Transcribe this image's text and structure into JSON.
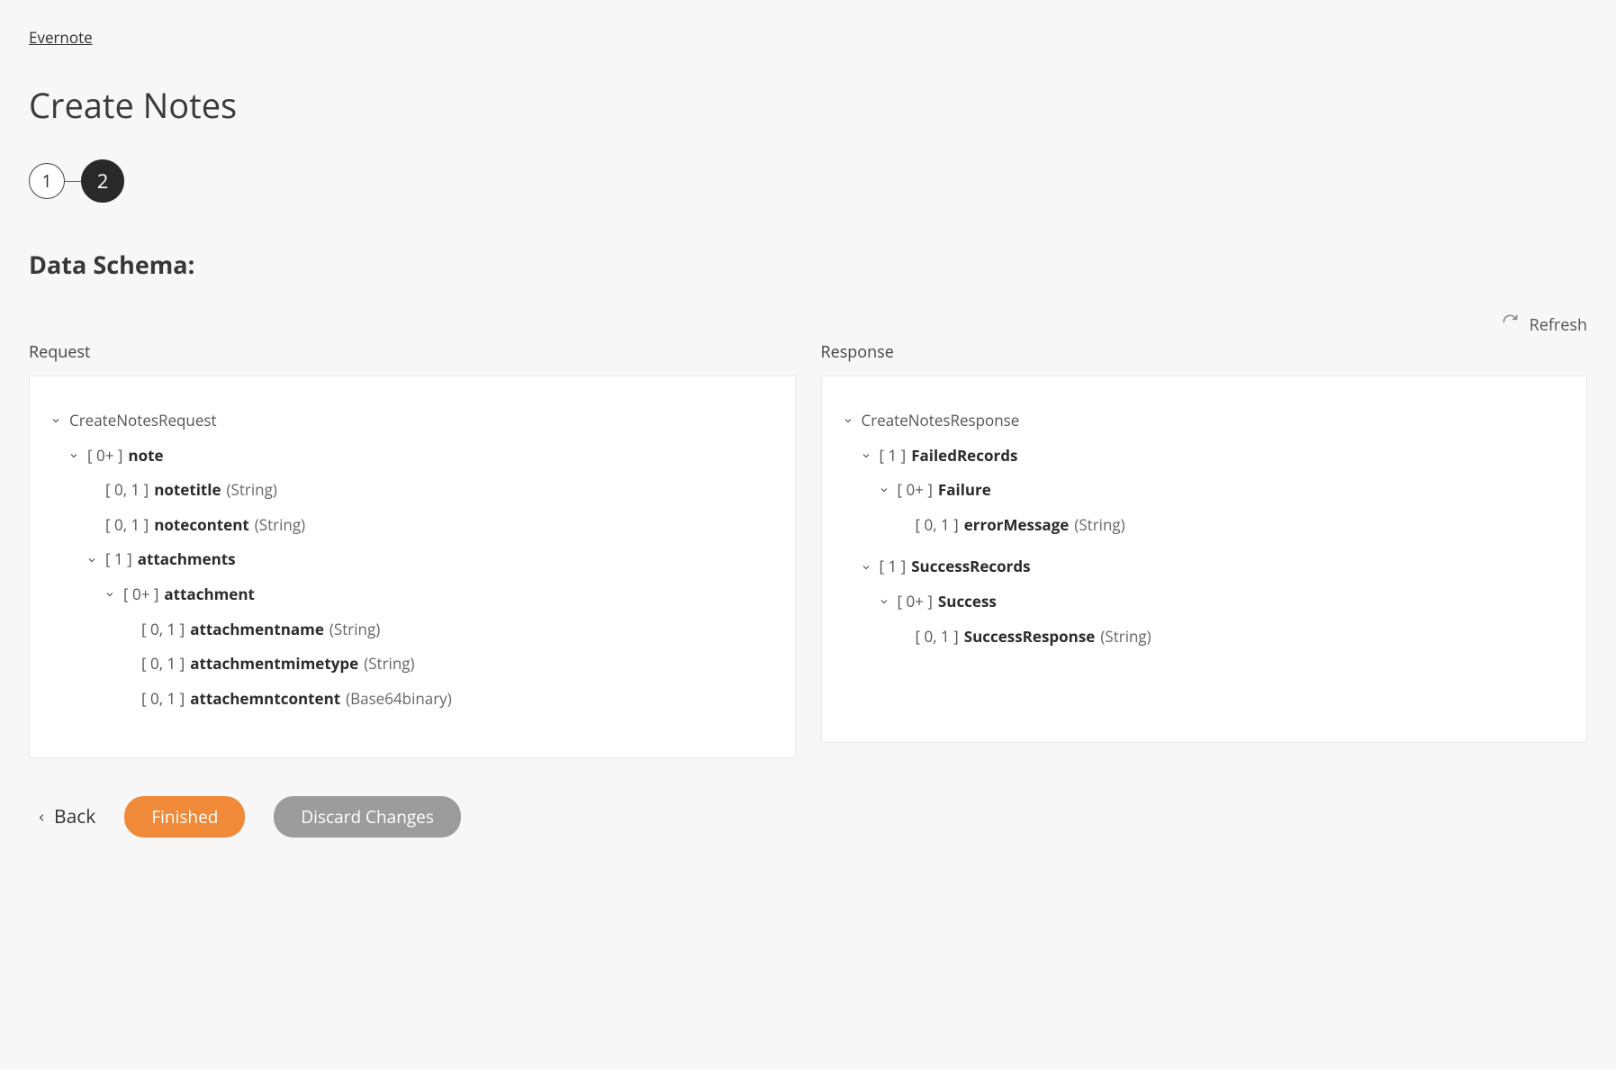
{
  "breadcrumb": "Evernote",
  "page_title": "Create Notes",
  "stepper": {
    "steps": [
      "1",
      "2"
    ],
    "active_index": 1
  },
  "section_title": "Data Schema:",
  "refresh_label": "Refresh",
  "request": {
    "label": "Request",
    "tree": {
      "name": "CreateNotesRequest",
      "is_root": true,
      "children": [
        {
          "card": "[ 0+ ]",
          "name": "note",
          "children": [
            {
              "card": "[ 0, 1 ]",
              "name": "notetitle",
              "type": "(String)"
            },
            {
              "card": "[ 0, 1 ]",
              "name": "notecontent",
              "type": "(String)"
            },
            {
              "card": "[ 1 ]",
              "name": "attachments",
              "children": [
                {
                  "card": "[ 0+ ]",
                  "name": "attachment",
                  "children": [
                    {
                      "card": "[ 0, 1 ]",
                      "name": "attachmentname",
                      "type": "(String)"
                    },
                    {
                      "card": "[ 0, 1 ]",
                      "name": "attachmentmimetype",
                      "type": "(String)"
                    },
                    {
                      "card": "[ 0, 1 ]",
                      "name": "attachemntcontent",
                      "type": "(Base64binary)"
                    }
                  ]
                }
              ]
            }
          ]
        }
      ]
    }
  },
  "response": {
    "label": "Response",
    "tree": {
      "name": "CreateNotesResponse",
      "is_root": true,
      "children": [
        {
          "card": "[ 1 ]",
          "name": "FailedRecords",
          "children": [
            {
              "card": "[ 0+ ]",
              "name": "Failure",
              "children": [
                {
                  "card": "[ 0, 1 ]",
                  "name": "errorMessage",
                  "type": "(String)"
                }
              ]
            }
          ]
        },
        {
          "card": "[ 1 ]",
          "name": "SuccessRecords",
          "children": [
            {
              "card": "[ 0+ ]",
              "name": "Success",
              "children": [
                {
                  "card": "[ 0, 1 ]",
                  "name": "SuccessResponse",
                  "type": "(String)"
                }
              ]
            }
          ]
        }
      ]
    }
  },
  "footer": {
    "back_label": "Back",
    "finished_label": "Finished",
    "discard_label": "Discard Changes"
  }
}
